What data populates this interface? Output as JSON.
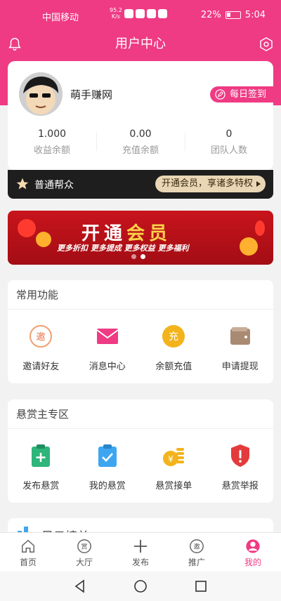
{
  "status_bar": {
    "carrier": "中国移动",
    "speed_value": "95.2",
    "speed_unit": "K/s",
    "battery": "22%",
    "time": "5:04"
  },
  "header": {
    "title": "用户中心"
  },
  "user": {
    "name": "萌手赚网",
    "signin_label": "每日签到",
    "stats": [
      {
        "value": "1.000",
        "label": "收益余额"
      },
      {
        "value": "0.00",
        "label": "充值余额"
      },
      {
        "value": "0",
        "label": "团队人数"
      }
    ]
  },
  "membership": {
    "level": "普通帮众",
    "vip_cta": "开通会员，享诸多特权"
  },
  "banner": {
    "headline_white": "开通",
    "headline_gold": "会员",
    "tagline": "更多折扣 更多提成 更多权益 更多福利"
  },
  "common_functions": {
    "title": "常用功能",
    "items": [
      {
        "label": "邀请好友",
        "icon": "invite-icon",
        "glyph": "邀"
      },
      {
        "label": "消息中心",
        "icon": "mail-icon"
      },
      {
        "label": "余额充值",
        "icon": "recharge-icon",
        "glyph": "充"
      },
      {
        "label": "申请提现",
        "icon": "wallet-icon"
      }
    ]
  },
  "reward_zone": {
    "title": "悬赏主专区",
    "items": [
      {
        "label": "发布悬赏",
        "icon": "clipboard-plus-icon"
      },
      {
        "label": "我的悬赏",
        "icon": "clipboard-check-icon"
      },
      {
        "label": "悬赏接单",
        "icon": "coins-icon"
      },
      {
        "label": "悬赏举报",
        "icon": "shield-alert-icon"
      }
    ]
  },
  "next_section": {
    "title_partial": "风云榜单"
  },
  "tabbar": [
    {
      "label": "首页",
      "icon": "home-icon",
      "active": false
    },
    {
      "label": "大厅",
      "icon": "hall-icon",
      "glyph": "赏",
      "active": false
    },
    {
      "label": "发布",
      "icon": "plus-icon",
      "active": false
    },
    {
      "label": "推广",
      "icon": "promote-icon",
      "glyph": "邀",
      "active": false
    },
    {
      "label": "我的",
      "icon": "profile-icon",
      "active": true
    }
  ],
  "colors": {
    "primary": "#ef3a84",
    "dark_bar": "#1e1e1e",
    "vip_gold": "#e9d6b4",
    "banner_red": "#c8141c"
  }
}
